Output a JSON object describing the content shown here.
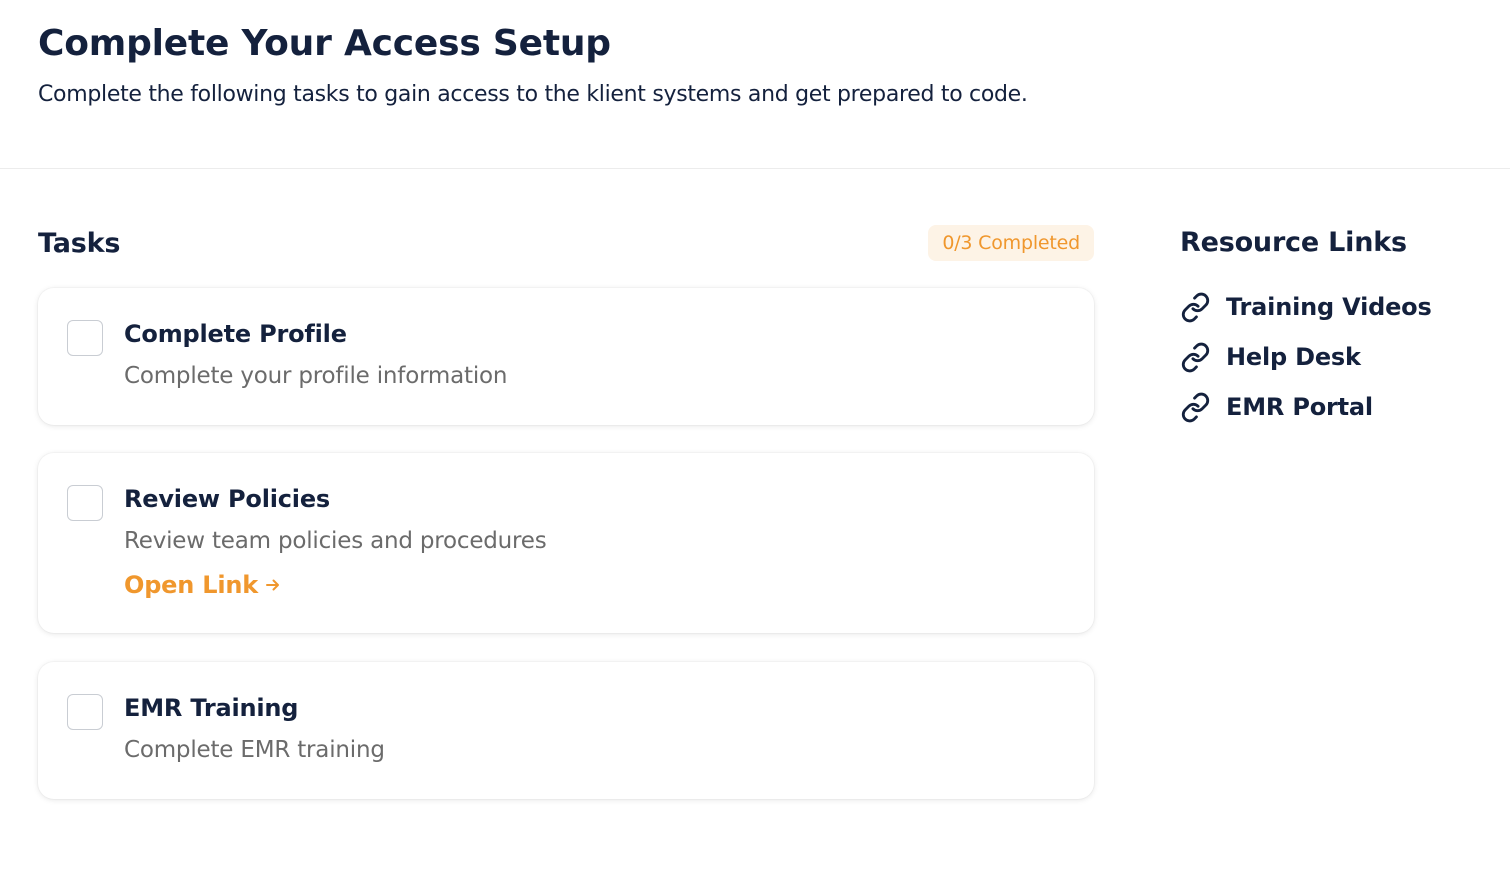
{
  "header": {
    "title": "Complete Your Access Setup",
    "subtitle": "Complete the following tasks to gain access to the klient systems and get prepared to code."
  },
  "tasks": {
    "heading": "Tasks",
    "progress_label": "0/3 Completed",
    "completed": 0,
    "total": 3,
    "items": [
      {
        "title": "Complete Profile",
        "description": "Complete your profile information",
        "checked": false
      },
      {
        "title": "Review Policies",
        "description": "Review team policies and procedures",
        "link_label": "Open Link",
        "link_icon": "arrow-right-icon",
        "checked": false
      },
      {
        "title": "EMR Training",
        "description": "Complete EMR training",
        "checked": false
      }
    ]
  },
  "resources": {
    "heading": "Resource Links",
    "icon": "link-icon",
    "items": [
      {
        "label": "Training Videos"
      },
      {
        "label": "Help Desk"
      },
      {
        "label": "EMR Portal"
      }
    ]
  },
  "colors": {
    "text_primary": "#14213d",
    "text_muted": "#6b6b6b",
    "accent": "#f0972d",
    "badge_bg": "#fdf3e6"
  }
}
